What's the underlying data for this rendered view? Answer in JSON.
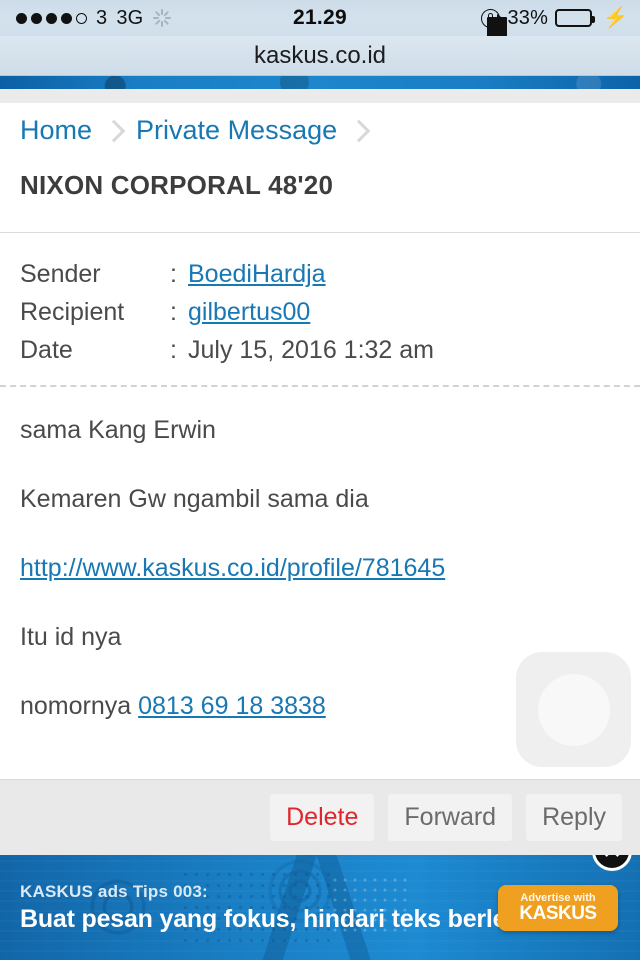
{
  "statusbar": {
    "signal_dots_filled": 4,
    "signal_dots_total": 5,
    "carrier": "3",
    "network": "3G",
    "time": "21.29",
    "battery_percent": "33%",
    "battery_level": 33,
    "charging": true,
    "rotation_lock": true,
    "loading": true
  },
  "browser": {
    "url": "kaskus.co.id"
  },
  "breadcrumb": {
    "items": [
      {
        "label": "Home"
      },
      {
        "label": "Private Message"
      }
    ]
  },
  "page": {
    "title": "NIXON CORPORAL 48'20"
  },
  "meta": {
    "sender_label": "Sender",
    "sender_value": "BoediHardja",
    "recipient_label": "Recipient",
    "recipient_value": "gilbertus00",
    "date_label": "Date",
    "date_value": "July 15, 2016 1:32 am",
    "separator": ":"
  },
  "message": {
    "line1": "sama Kang Erwin",
    "line2": "Kemaren Gw ngambil sama dia",
    "link_url": "http://www.kaskus.co.id/profile/781645",
    "line3": "Itu id nya",
    "line4_prefix": "nomornya ",
    "phone": "0813 69 18 3838"
  },
  "actions": {
    "delete": "Delete",
    "forward": "Forward",
    "reply": "Reply"
  },
  "ad": {
    "tips": "KASKUS ads Tips 003:",
    "headline": "Buat pesan yang fokus, hindari teks berlebihan",
    "cta_small": "Advertise with",
    "cta_big": "KASKUS",
    "close": "✕"
  },
  "colors": {
    "link": "#1878b4",
    "danger": "#e0262c",
    "brand_blue": "#1a80c6",
    "cta_orange": "#f0a020",
    "battery_green": "#3ddb4a"
  }
}
